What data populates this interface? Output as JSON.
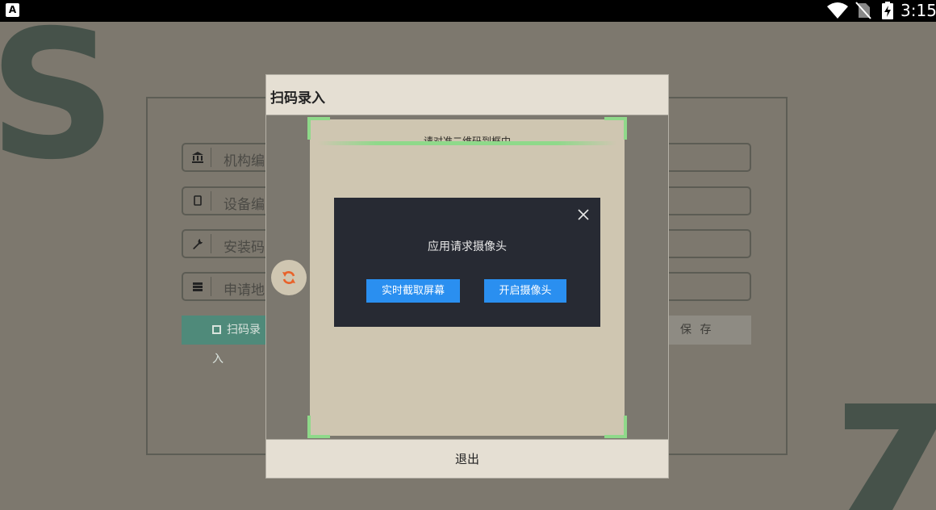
{
  "status_bar": {
    "app_badge": "A",
    "time": "3:15"
  },
  "background_form": {
    "fields": [
      {
        "icon": "bank-icon",
        "placeholder": "机构编"
      },
      {
        "icon": "tablet-icon",
        "placeholder": "设备编"
      },
      {
        "icon": "wrench-icon",
        "placeholder": "安装码"
      },
      {
        "icon": "server-icon",
        "placeholder": "申请地"
      }
    ],
    "scan_button": "扫码录入",
    "save_button": "保 存"
  },
  "scan_dialog": {
    "title": "扫码录入",
    "hint": "请对准二维码到框中",
    "exit_button": "退出"
  },
  "camera_popup": {
    "message": "应用请求摄像头",
    "screen_capture_button": "实时截取屏幕",
    "open_camera_button": "开启摄像头"
  },
  "colors": {
    "accent_blue": "#2a8ff0",
    "scan_green": "#8fd98a",
    "refresh_orange": "#e8622a",
    "teal_button": "#4f8a7a"
  }
}
